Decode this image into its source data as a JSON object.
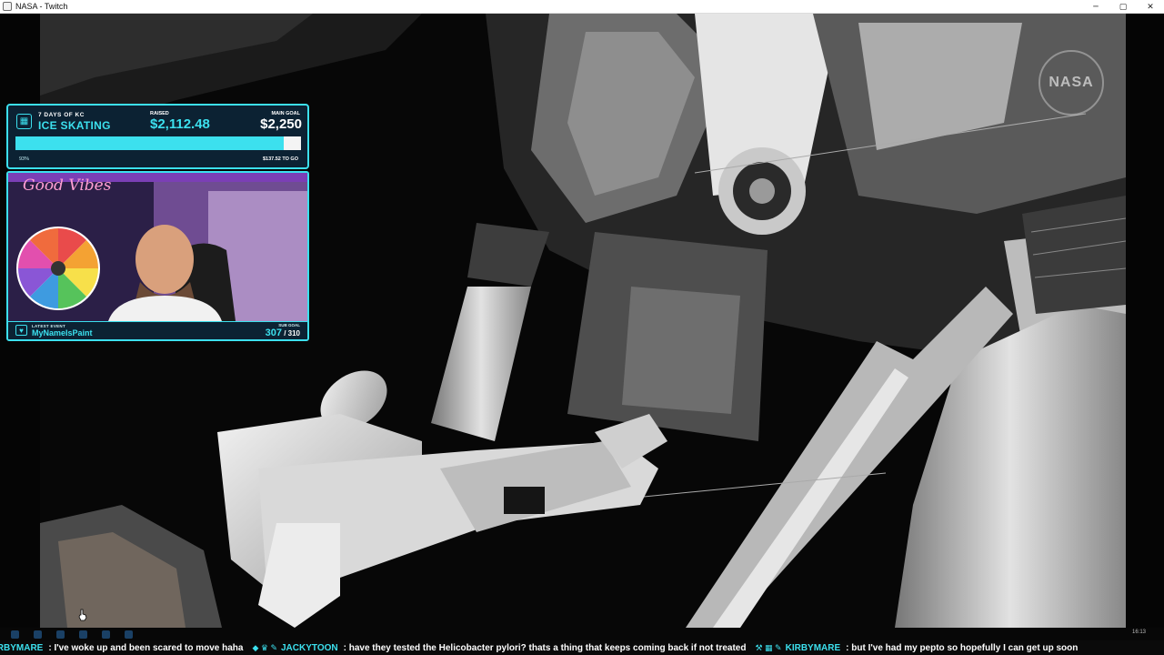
{
  "window": {
    "title": "NASA - Twitch",
    "controls": {
      "minimize": "─",
      "maximize": "▢",
      "close": "✕"
    }
  },
  "video": {
    "logo_text": "NASA"
  },
  "goal_widget": {
    "icon": "calendar-icon",
    "subtitle": "7 DAYS OF KC",
    "title": "ICE SKATING",
    "raised_label": "RAISED",
    "raised_value": "$2,112.48",
    "main_goal_label": "MAIN GOAL",
    "main_goal_value": "$2,250",
    "progress_fraction": 0.94,
    "percent_text": "93%",
    "remaining_text": "$137.52 TO GO",
    "accent_color": "#3ce0ee"
  },
  "cam_widget": {
    "neon_sign": "Good Vibes",
    "latest_event_label": "LATEST EVENT",
    "latest_event_name": "MyNameIsPaint",
    "sub_goal_label": "SUB GOAL",
    "sub_current": "307",
    "sub_total": " / 310"
  },
  "ticker": [
    {
      "name": "IRBYMARE",
      "message": ": I've woke up and been scared to move haha"
    },
    {
      "name": "JACKYTOON",
      "message": ": have they tested the Helicobacter pylori? thats a thing that keeps coming back if not treated"
    },
    {
      "name": "KIRBYMARE",
      "message": ": but I've had my pepto so hopefully I can get up soon"
    }
  ],
  "tray": {
    "time": "16:13"
  }
}
